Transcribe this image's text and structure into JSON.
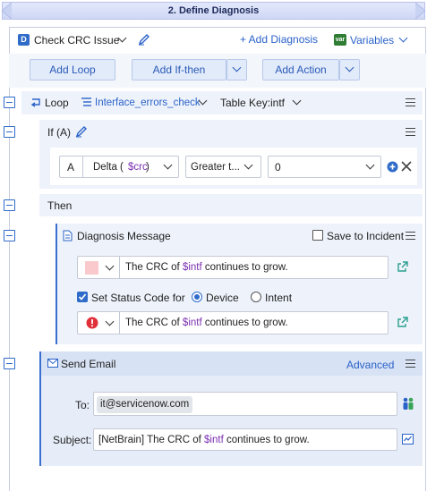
{
  "title": "2. Define Diagnosis",
  "header": {
    "badge": "D",
    "diagnosis_name": "Check CRC Issue",
    "add_diagnosis": "+ Add Diagnosis",
    "variables_badge": "var",
    "variables": "Variables"
  },
  "toolbar": {
    "add_loop": "Add Loop",
    "add_if_then": "Add If-then",
    "add_action": "Add Action"
  },
  "loop": {
    "label": "Loop",
    "table_name": "Interface_errors_check",
    "table_key_label": "Table Key:",
    "table_key_value": "intf"
  },
  "if_block": {
    "label": "If (A)",
    "cond_letter": "A",
    "operand_prefix": "Delta (",
    "operand_var": "$crc",
    "operand_suffix": ")",
    "operator": "Greater t...",
    "value": "0"
  },
  "then_block": {
    "label": "Then"
  },
  "diag_message": {
    "label": "Diagnosis Message",
    "save_to_incident": "Save to Incident",
    "save_to_incident_checked": false,
    "msg_prefix": "The CRC of ",
    "msg_var": "$intf",
    "msg_suffix": " continues to grow.",
    "set_status_label": "Set Status Code for",
    "set_status_checked": true,
    "radio_device": "Device",
    "radio_intent": "Intent",
    "radio_selected": "Device",
    "status_msg_prefix": "The CRC of ",
    "status_msg_var": "$intf",
    "status_msg_suffix": " continues to grow."
  },
  "send_email": {
    "label": "Send Email",
    "advanced": "Advanced",
    "to_label": "To:",
    "to_chip": "it@servicenow.com",
    "subject_label": "Subject:",
    "subject_prefix": "[NetBrain] The CRC of ",
    "subject_var": "$intf",
    "subject_suffix": " continues to grow."
  },
  "colors": {
    "accent": "#2a62c8",
    "variable": "#7a2fb0",
    "error": "#e0303a",
    "section_bg": "#eef3fb"
  }
}
